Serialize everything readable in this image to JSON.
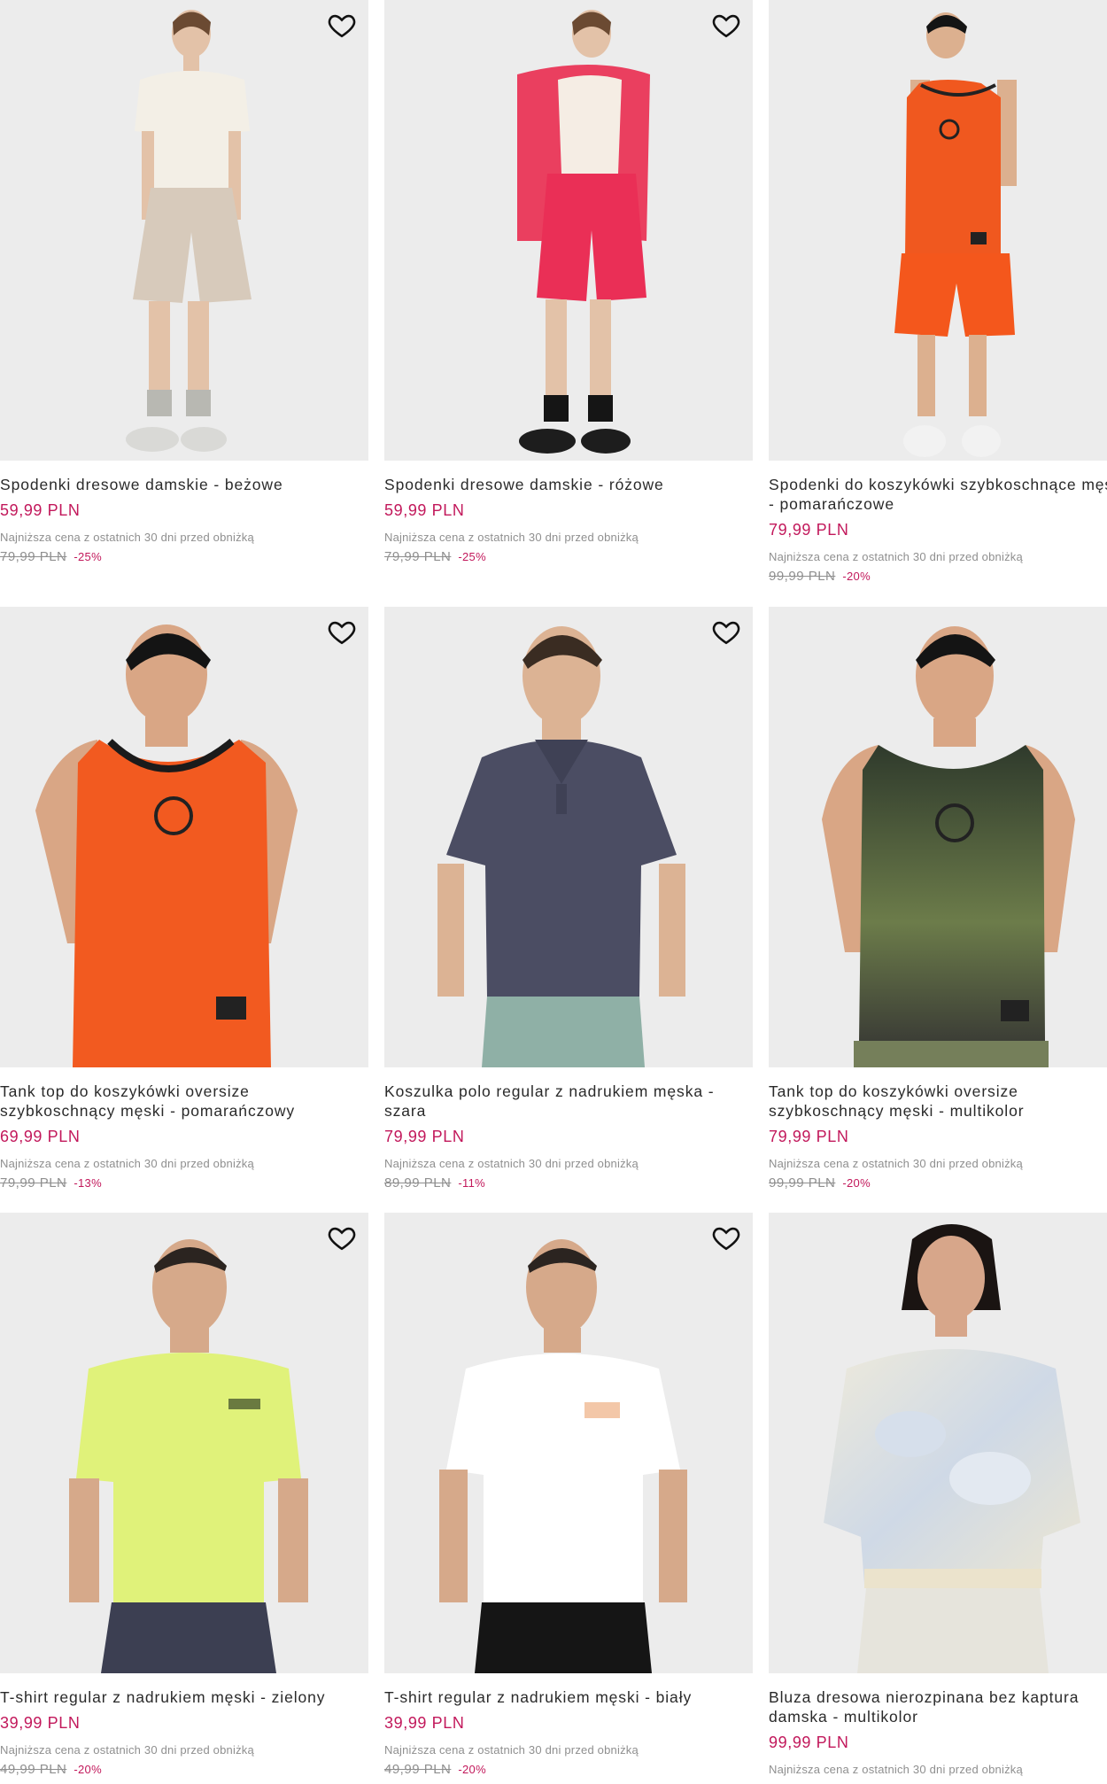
{
  "lowest_price_label": "Najniższa cena z ostatnich 30 dni przed obniżką",
  "favorite_icon": "heart-outline-icon",
  "colors": {
    "accent": "#c2185b",
    "muted": "#8f8f8f",
    "image_bg": "#ececec"
  },
  "products": [
    {
      "title": "Spodenki dresowe damskie - beżowe",
      "price": "59,99 PLN",
      "old_price": "79,99 PLN",
      "discount": "-25%"
    },
    {
      "title": "Spodenki dresowe damskie - różowe",
      "price": "59,99 PLN",
      "old_price": "79,99 PLN",
      "discount": "-25%"
    },
    {
      "title": "Spodenki do koszykówki szybkoschnące męskie - pomarańczowe",
      "price": "79,99 PLN",
      "old_price": "99,99 PLN",
      "discount": "-20%"
    },
    {
      "title": "Tank top do koszykówki oversize szybkoschnący męski - pomarańczowy",
      "price": "69,99 PLN",
      "old_price": "79,99 PLN",
      "discount": "-13%"
    },
    {
      "title": "Koszulka polo regular z nadrukiem męska - szara",
      "price": "79,99 PLN",
      "old_price": "89,99 PLN",
      "discount": "-11%"
    },
    {
      "title": "Tank top do koszykówki oversize szybkoschnący męski - multikolor",
      "price": "79,99 PLN",
      "old_price": "99,99 PLN",
      "discount": "-20%"
    },
    {
      "title": "T-shirt regular z nadrukiem męski - zielony",
      "price": "39,99 PLN",
      "old_price": "49,99 PLN",
      "discount": "-20%"
    },
    {
      "title": "T-shirt regular z nadrukiem męski - biały",
      "price": "39,99 PLN",
      "old_price": "49,99 PLN",
      "discount": "-20%"
    },
    {
      "title": "Bluza dresowa nierozpinana bez kaptura damska - multikolor",
      "price": "99,99 PLN"
    }
  ]
}
